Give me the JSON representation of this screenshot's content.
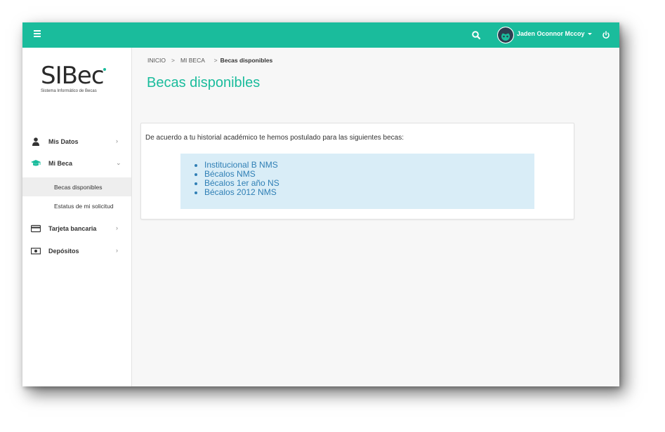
{
  "header": {
    "user_name": "Jaden Oconnor Mccoy"
  },
  "logo": {
    "title": "SIBec",
    "subtitle": "Sistema Informático de Becas"
  },
  "sidebar": {
    "items": [
      {
        "label": "Mis Datos",
        "icon": "user-icon"
      },
      {
        "label": "Mi Beca",
        "icon": "graduation-cap-icon",
        "expanded": true,
        "children": [
          {
            "label": "Becas disponibles",
            "active": true
          },
          {
            "label": "Estatus de mi solicitud"
          }
        ]
      },
      {
        "label": "Tarjeta bancaria",
        "icon": "credit-card-icon"
      },
      {
        "label": "Depósitos",
        "icon": "money-icon"
      }
    ]
  },
  "breadcrumb": {
    "items": [
      "INICIO",
      "MI BECA",
      "Becas disponibles"
    ]
  },
  "page": {
    "title": "Becas disponibles",
    "intro": "De acuerdo a tu historial académico te hemos postulado para las siguientes becas:",
    "becas": [
      "Institucional B NMS",
      "Bécalos NMS",
      "Bécalos 1er año NS",
      "Bécalos 2012 NMS"
    ]
  },
  "colors": {
    "accent": "#1abc9c",
    "list_bg": "#d9edf7",
    "list_text": "#2f7fb5"
  }
}
